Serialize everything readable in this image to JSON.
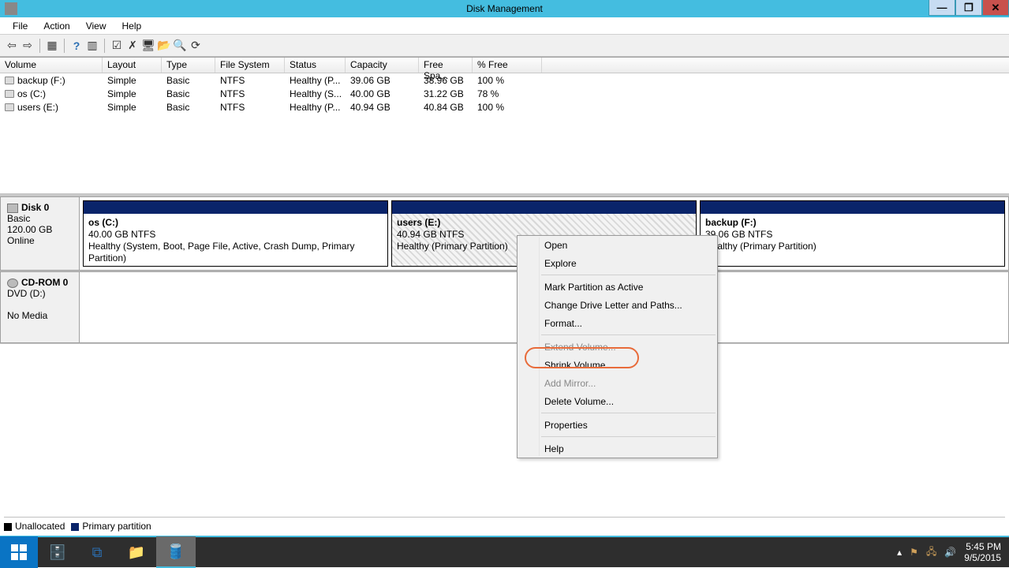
{
  "title": "Disk Management",
  "menu": {
    "file": "File",
    "action": "Action",
    "view": "View",
    "help": "Help"
  },
  "columns": {
    "volume": "Volume",
    "layout": "Layout",
    "type": "Type",
    "fs": "File System",
    "status": "Status",
    "capacity": "Capacity",
    "free": "Free Spa...",
    "pct": "% Free"
  },
  "volumes": [
    {
      "name": "backup (F:)",
      "layout": "Simple",
      "type": "Basic",
      "fs": "NTFS",
      "status": "Healthy (P...",
      "capacity": "39.06 GB",
      "free": "38.96 GB",
      "pct": "100 %"
    },
    {
      "name": "os (C:)",
      "layout": "Simple",
      "type": "Basic",
      "fs": "NTFS",
      "status": "Healthy (S...",
      "capacity": "40.00 GB",
      "free": "31.22 GB",
      "pct": "78 %"
    },
    {
      "name": "users (E:)",
      "layout": "Simple",
      "type": "Basic",
      "fs": "NTFS",
      "status": "Healthy (P...",
      "capacity": "40.94 GB",
      "free": "40.84 GB",
      "pct": "100 %"
    }
  ],
  "disk0": {
    "label": "Disk 0",
    "type": "Basic",
    "size": "120.00 GB",
    "state": "Online",
    "parts": [
      {
        "name": "os  (C:)",
        "line2": "40.00 GB NTFS",
        "line3": "Healthy (System, Boot, Page File, Active, Crash Dump, Primary Partition)"
      },
      {
        "name": "users  (E:)",
        "line2": "40.94 GB NTFS",
        "line3": "Healthy (Primary Partition)"
      },
      {
        "name": "backup  (F:)",
        "line2": "39.06 GB NTFS",
        "line3": "Healthy (Primary Partition)"
      }
    ]
  },
  "cdrom": {
    "label": "CD-ROM 0",
    "line2": "DVD (D:)",
    "line3": "No Media"
  },
  "legend": {
    "unalloc": "Unallocated",
    "primary": "Primary partition"
  },
  "ctx": {
    "open": "Open",
    "explore": "Explore",
    "markactive": "Mark Partition as Active",
    "changeletter": "Change Drive Letter and Paths...",
    "format": "Format...",
    "extend": "Extend Volume...",
    "shrink": "Shrink Volume...",
    "addmirror": "Add Mirror...",
    "delete": "Delete Volume...",
    "properties": "Properties",
    "help": "Help"
  },
  "tray": {
    "time": "5:45 PM",
    "date": "9/5/2015"
  }
}
